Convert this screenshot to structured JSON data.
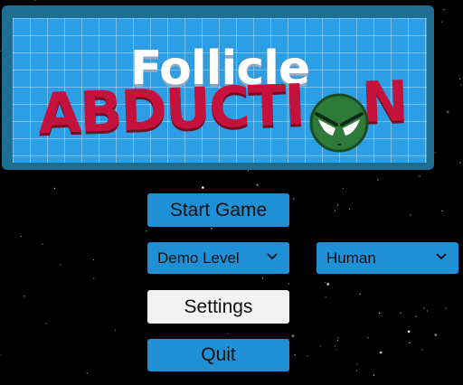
{
  "logo": {
    "line1": "Follicle",
    "line2": "ABDUCTI",
    "line3": "N"
  },
  "menu": {
    "start_label": "Start Game",
    "level_selected": "Demo Level",
    "species_selected": "Human",
    "settings_label": "Settings",
    "quit_label": "Quit"
  },
  "icons": {
    "alien": "alien-head-icon",
    "dropdown": "chevron-down-icon"
  },
  "colors": {
    "background": "#000000",
    "logo_frame": "#1e6e94",
    "logo_panel": "#2b9ee6",
    "title_red": "#c4123c",
    "button_blue": "#1f8fd6",
    "button_selected": "#f2f2f2",
    "alien_green": "#2d7a3a"
  }
}
